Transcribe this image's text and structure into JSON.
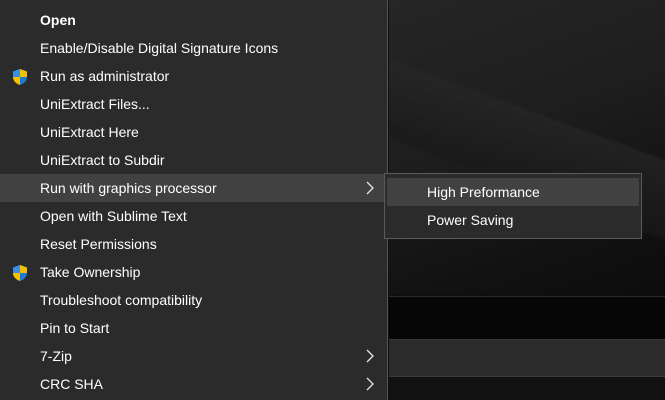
{
  "menu": {
    "items": [
      {
        "label": "Open",
        "bold": true,
        "icon": "",
        "submenu": false
      },
      {
        "label": "Enable/Disable Digital Signature Icons",
        "icon": "",
        "submenu": false
      },
      {
        "label": "Run as administrator",
        "icon": "uac-shield-icon",
        "submenu": false
      },
      {
        "label": "UniExtract Files...",
        "icon": "",
        "submenu": false
      },
      {
        "label": "UniExtract Here",
        "icon": "",
        "submenu": false
      },
      {
        "label": "UniExtract to Subdir",
        "icon": "",
        "submenu": false
      },
      {
        "label": "Run with graphics processor",
        "icon": "",
        "submenu": true,
        "active": true
      },
      {
        "label": "Open with Sublime Text",
        "icon": "",
        "submenu": false
      },
      {
        "label": "Reset Permissions",
        "icon": "",
        "submenu": false
      },
      {
        "label": "Take Ownership",
        "icon": "uac-shield-icon",
        "submenu": false
      },
      {
        "label": "Troubleshoot compatibility",
        "icon": "",
        "submenu": false
      },
      {
        "label": "Pin to Start",
        "icon": "",
        "submenu": false
      },
      {
        "label": "7-Zip",
        "icon": "",
        "submenu": true
      },
      {
        "label": "CRC SHA",
        "icon": "",
        "submenu": true
      }
    ]
  },
  "submenu": {
    "items": [
      {
        "label": "High Preformance",
        "active": true
      },
      {
        "label": "Power Saving"
      }
    ]
  },
  "colors": {
    "menu_bg": "#2b2b2b",
    "hover_bg": "#414141",
    "text": "#ffffff",
    "shield_blue": "#1e7ad6",
    "shield_yellow": "#f2c200"
  }
}
